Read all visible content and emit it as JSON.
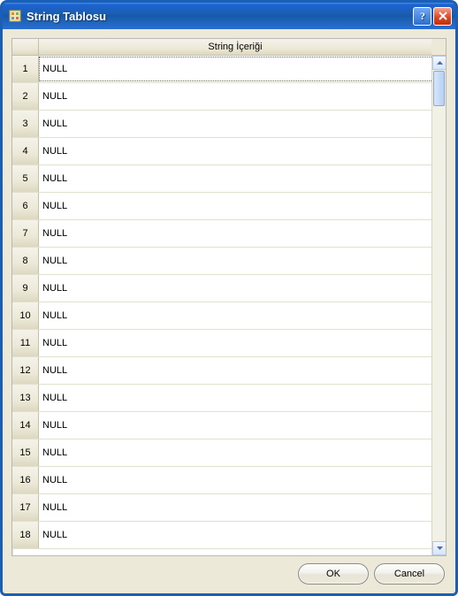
{
  "window": {
    "title": "String Tablosu"
  },
  "grid": {
    "column_header": "String İçeriği",
    "rows": [
      {
        "n": "1",
        "v": "NULL"
      },
      {
        "n": "2",
        "v": "NULL"
      },
      {
        "n": "3",
        "v": "NULL"
      },
      {
        "n": "4",
        "v": "NULL"
      },
      {
        "n": "5",
        "v": "NULL"
      },
      {
        "n": "6",
        "v": "NULL"
      },
      {
        "n": "7",
        "v": "NULL"
      },
      {
        "n": "8",
        "v": "NULL"
      },
      {
        "n": "9",
        "v": "NULL"
      },
      {
        "n": "10",
        "v": "NULL"
      },
      {
        "n": "11",
        "v": "NULL"
      },
      {
        "n": "12",
        "v": "NULL"
      },
      {
        "n": "13",
        "v": "NULL"
      },
      {
        "n": "14",
        "v": "NULL"
      },
      {
        "n": "15",
        "v": "NULL"
      },
      {
        "n": "16",
        "v": "NULL"
      },
      {
        "n": "17",
        "v": "NULL"
      },
      {
        "n": "18",
        "v": "NULL"
      }
    ],
    "selected_index": 0
  },
  "buttons": {
    "ok": "OK",
    "cancel": "Cancel"
  }
}
